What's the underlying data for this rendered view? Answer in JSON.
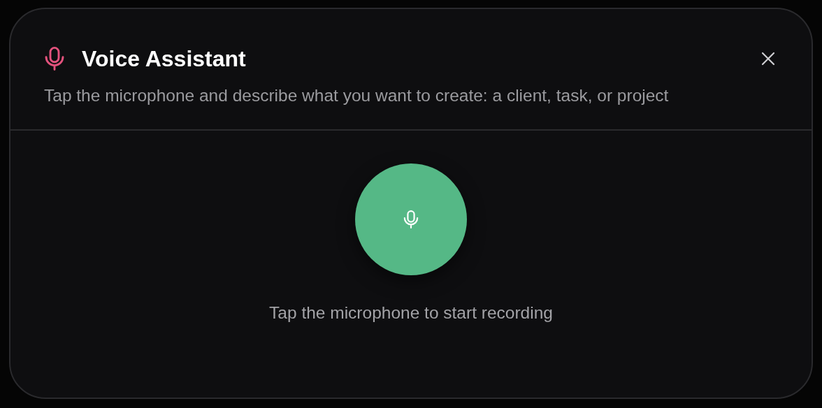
{
  "dialog": {
    "title": "Voice Assistant",
    "description": "Tap the microphone and describe what you want to create: a client, task, or project",
    "recording": false,
    "hint": "Tap the microphone to start recording"
  }
}
